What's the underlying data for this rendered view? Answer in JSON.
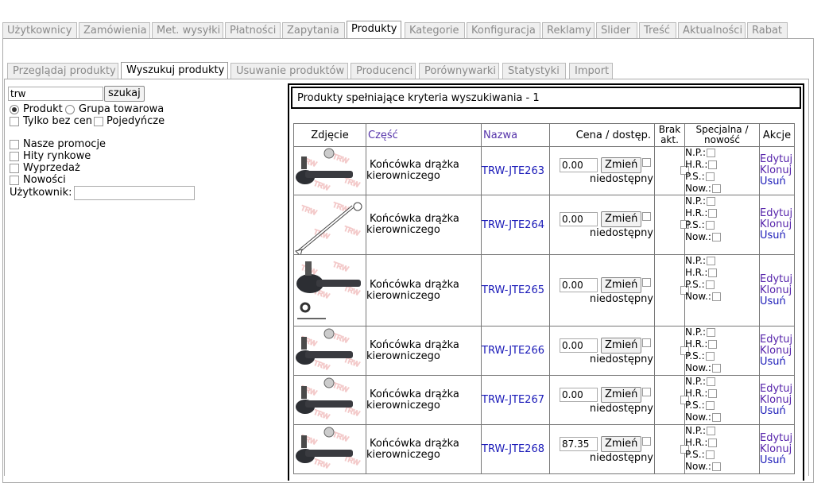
{
  "main_tabs": [
    "Użytkownicy",
    "Zamówienia",
    "Met. wysyłki",
    "Płatności",
    "Zapytania",
    "Produkty",
    "Kategorie",
    "Konfiguracja",
    "Reklamy",
    "Slider",
    "Treść",
    "Aktualności",
    "Rabat"
  ],
  "main_tab_active": "Produkty",
  "sub_tabs": [
    "Przeglądaj produkty",
    "Wyszukuj produkty",
    "Usuwanie produktów",
    "Producenci",
    "Porównywarki",
    "Statystyki",
    "Import"
  ],
  "sub_tab_active": "Wyszukuj produkty",
  "search": {
    "query": "trw",
    "button": "szukaj",
    "radio_product": "Produkt",
    "radio_group": "Grupa towarowa",
    "only_no_price": "Tylko bez cen",
    "single": "Pojedyńcze",
    "filters": [
      "Nasze promocje",
      "Hity rynkowe",
      "Wyprzedaż",
      "Nowości"
    ],
    "user_label": "Użytkownik:",
    "user_value": ""
  },
  "results": {
    "header": "Produkty spełniające kryteria wyszukiwania - 1",
    "columns": {
      "image": "Zdjęcie",
      "part": "Część",
      "name": "Nazwa",
      "price": "Cena / dostęp.",
      "brak": "Brak akt.",
      "special": "Specjalna / nowość",
      "actions": "Akcje"
    },
    "change_button": "Zmień",
    "availability": "niedostępny",
    "spec_labels": [
      "N.P.:",
      "H.R.:",
      "P.S.:",
      "Now.:"
    ],
    "action_labels": [
      "Edytuj",
      "Klonuj",
      "Usuń"
    ],
    "rows": [
      {
        "part_line1": "Końcówka drążka",
        "part_line2": "kierowniczego",
        "name": "TRW-JTE263",
        "price": "0.00"
      },
      {
        "part_line1": "Końcówka drążka",
        "part_line2": "kierowniczego",
        "name": "TRW-JTE264",
        "price": "0.00"
      },
      {
        "part_line1": "Końcówka drążka",
        "part_line2": "kierowniczego",
        "name": "TRW-JTE265",
        "price": "0.00"
      },
      {
        "part_line1": "Końcówka drążka",
        "part_line2": "kierowniczego",
        "name": "TRW-JTE266",
        "price": "0.00"
      },
      {
        "part_line1": "Końcówka drążka",
        "part_line2": "kierowniczego",
        "name": "TRW-JTE267",
        "price": "0.00"
      },
      {
        "part_line1": "Końcówka drążka",
        "part_line2": "kierowniczego",
        "name": "TRW-JTE268",
        "price": "87.35"
      }
    ]
  }
}
